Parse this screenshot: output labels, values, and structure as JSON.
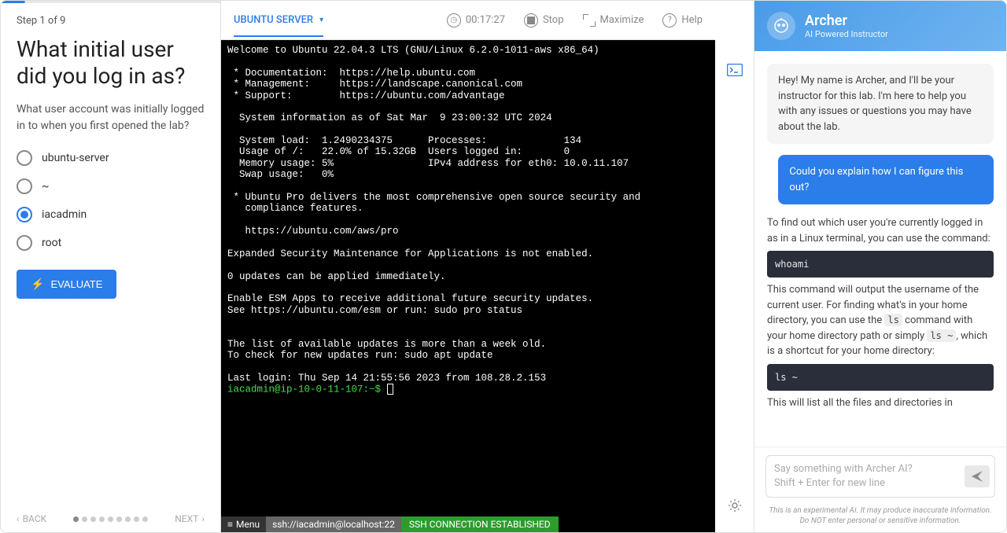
{
  "left": {
    "step": "Step 1 of 9",
    "title": "What initial user did you log in as?",
    "desc": "What user account was initially logged in to when you first opened the lab?",
    "options": [
      "ubuntu-server",
      "~",
      "iacadmin",
      "root"
    ],
    "selected_index": 2,
    "evaluate": "EVALUATE",
    "back": "BACK",
    "next": "NEXT",
    "total_steps": 9,
    "current_step": 1
  },
  "mid": {
    "server_tab": "UBUNTU SERVER",
    "timer": "00:17:27",
    "stop": "Stop",
    "maximize": "Maximize",
    "help": "Help",
    "terminal_text": "Welcome to Ubuntu 22.04.3 LTS (GNU/Linux 6.2.0-1011-aws x86_64)\n\n * Documentation:  https://help.ubuntu.com\n * Management:     https://landscape.canonical.com\n * Support:        https://ubuntu.com/advantage\n\n  System information as of Sat Mar  9 23:00:32 UTC 2024\n\n  System load:  1.2490234375      Processes:             134\n  Usage of /:   22.0% of 15.32GB  Users logged in:       0\n  Memory usage: 5%                IPv4 address for eth0: 10.0.11.107\n  Swap usage:   0%\n\n * Ubuntu Pro delivers the most comprehensive open source security and\n   compliance features.\n\n   https://ubuntu.com/aws/pro\n\nExpanded Security Maintenance for Applications is not enabled.\n\n0 updates can be applied immediately.\n\nEnable ESM Apps to receive additional future security updates.\nSee https://ubuntu.com/esm or run: sudo pro status\n\n\nThe list of available updates is more than a week old.\nTo check for new updates run: sudo apt update\n\nLast login: Thu Sep 14 21:55:56 2023 from 108.28.2.153",
    "prompt": "iacadmin@ip-10-0-11-107:~$ ",
    "menu": "Menu",
    "ssh": "ssh://iacadmin@localhost:22",
    "status": "SSH CONNECTION ESTABLISHED"
  },
  "chat": {
    "name": "Archer",
    "subtitle": "AI Powered Instructor",
    "intro": "Hey! My name is Archer, and I'll be your instructor for this lab. I'm here to help you with any issues or questions you may have about the lab.",
    "user_msg": "Could you explain how I can figure this out?",
    "resp1": "To find out which user you're currently logged in as in a Linux terminal, you can use the command:",
    "code1": "whoami",
    "resp2a": "This command will output the username of the current user. For finding what's in your home directory, you can use the ",
    "resp2b": " command with your home directory path or simply ",
    "resp2c": ", which is a shortcut for your home directory:",
    "inline_ls": "ls",
    "inline_lst": "ls ~",
    "code2": "ls ~",
    "resp3": "This will list all the files and directories in",
    "placeholder1": "Say something with Archer AI?",
    "placeholder2": "Shift + Enter for new line",
    "disclaimer1": "This is an experimental AI. It may produce inaccurate information.",
    "disclaimer2": "Do NOT enter personal or sensitive information."
  }
}
